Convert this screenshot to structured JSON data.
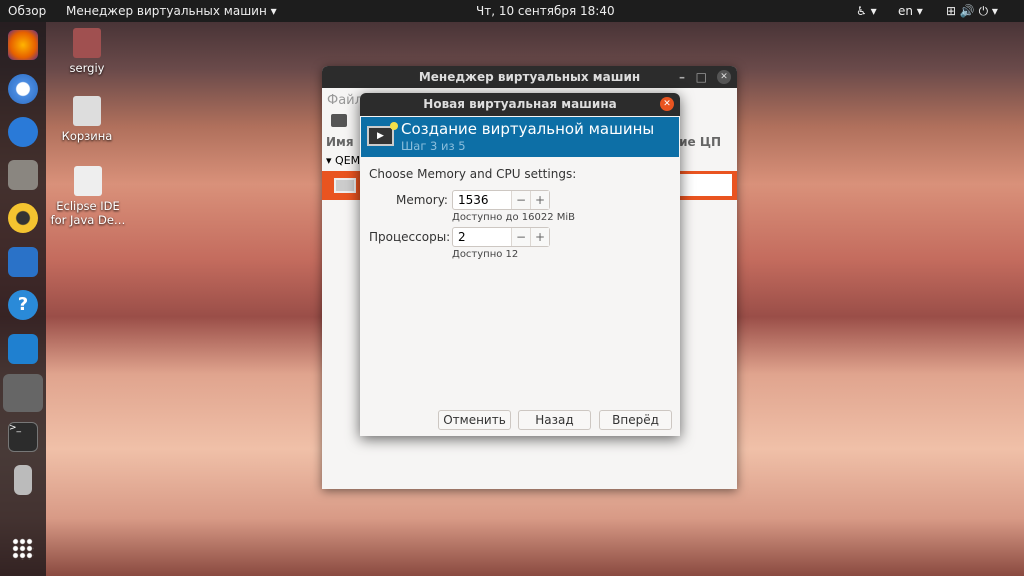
{
  "topbar": {
    "activities": "Обзор",
    "app_menu": "Менеджер виртуальных машин ▾",
    "clock": "Чт, 10 сентября  18:40",
    "accessibility": "♿ ▾",
    "lang": "en ▾",
    "system": "⊞ 🔊 ⏻ ▾"
  },
  "dock": {
    "items": [
      "firefox-icon",
      "chromium-icon",
      "thunderbird-icon",
      "files-icon",
      "rhythmbox-icon",
      "writer-icon",
      "help-icon",
      "vscode-icon",
      "virt-manager-icon",
      "terminal-icon",
      "usb-icon",
      "apps-grid-icon"
    ]
  },
  "desktop": {
    "icons": [
      {
        "label": "sergiy"
      },
      {
        "label": "Корзина"
      },
      {
        "label": "Eclipse IDE for Java De…"
      }
    ]
  },
  "main_window": {
    "title": "Менеджер виртуальных машин",
    "menu_file": "Файл",
    "col_name": "Имя",
    "col_cpu": "ние ЦП",
    "group": "QEM"
  },
  "dialog": {
    "title": "Новая виртуальная машина",
    "header_title": "Создание виртуальной машины",
    "header_step": "Шаг 3 из 5",
    "prompt": "Choose Memory and CPU settings:",
    "memory_label": "Memory:",
    "memory_value": "1536",
    "memory_hint": "Доступно до 16022 MiB",
    "cpu_label": "Процессоры:",
    "cpu_value": "2",
    "cpu_hint": "Доступно 12",
    "minus": "−",
    "plus": "+",
    "cancel": "Отменить",
    "back": "Назад",
    "forward": "Вперёд"
  },
  "colors": {
    "header_blue": "#0d6fa6",
    "selection_orange": "#e95420"
  }
}
